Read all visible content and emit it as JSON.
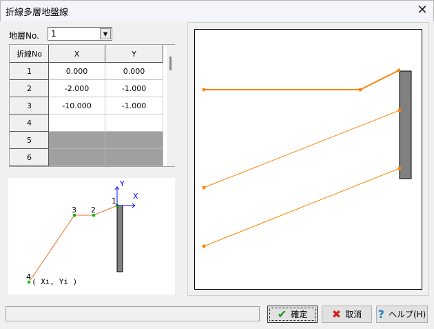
{
  "window": {
    "title": "折線多層地盤線",
    "close_icon": "close-icon"
  },
  "layer": {
    "label": "地層No.",
    "value": "1"
  },
  "grid": {
    "headers": [
      "折線No",
      "X",
      "Y"
    ],
    "rows": [
      {
        "no": "1",
        "x": "0.000",
        "y": "0.000"
      },
      {
        "no": "2",
        "x": "-2.000",
        "y": "-1.000"
      },
      {
        "no": "3",
        "x": "-10.000",
        "y": "-1.000"
      },
      {
        "no": "4",
        "x": "",
        "y": ""
      },
      {
        "no": "5",
        "x": "",
        "y": ""
      },
      {
        "no": "6",
        "x": "",
        "y": ""
      }
    ]
  },
  "diagram": {
    "point_labels": [
      "1",
      "2",
      "3",
      "4"
    ],
    "axis_x": "X",
    "axis_y": "Y",
    "coord_label": "( Xi, Yi )"
  },
  "buttons": {
    "ok": "確定",
    "cancel": "取消",
    "help": "ヘルプ(H)"
  },
  "colors": {
    "line": "#ff8000",
    "axis": "#0000ff",
    "point": "#00c000",
    "wall": "#808080"
  }
}
